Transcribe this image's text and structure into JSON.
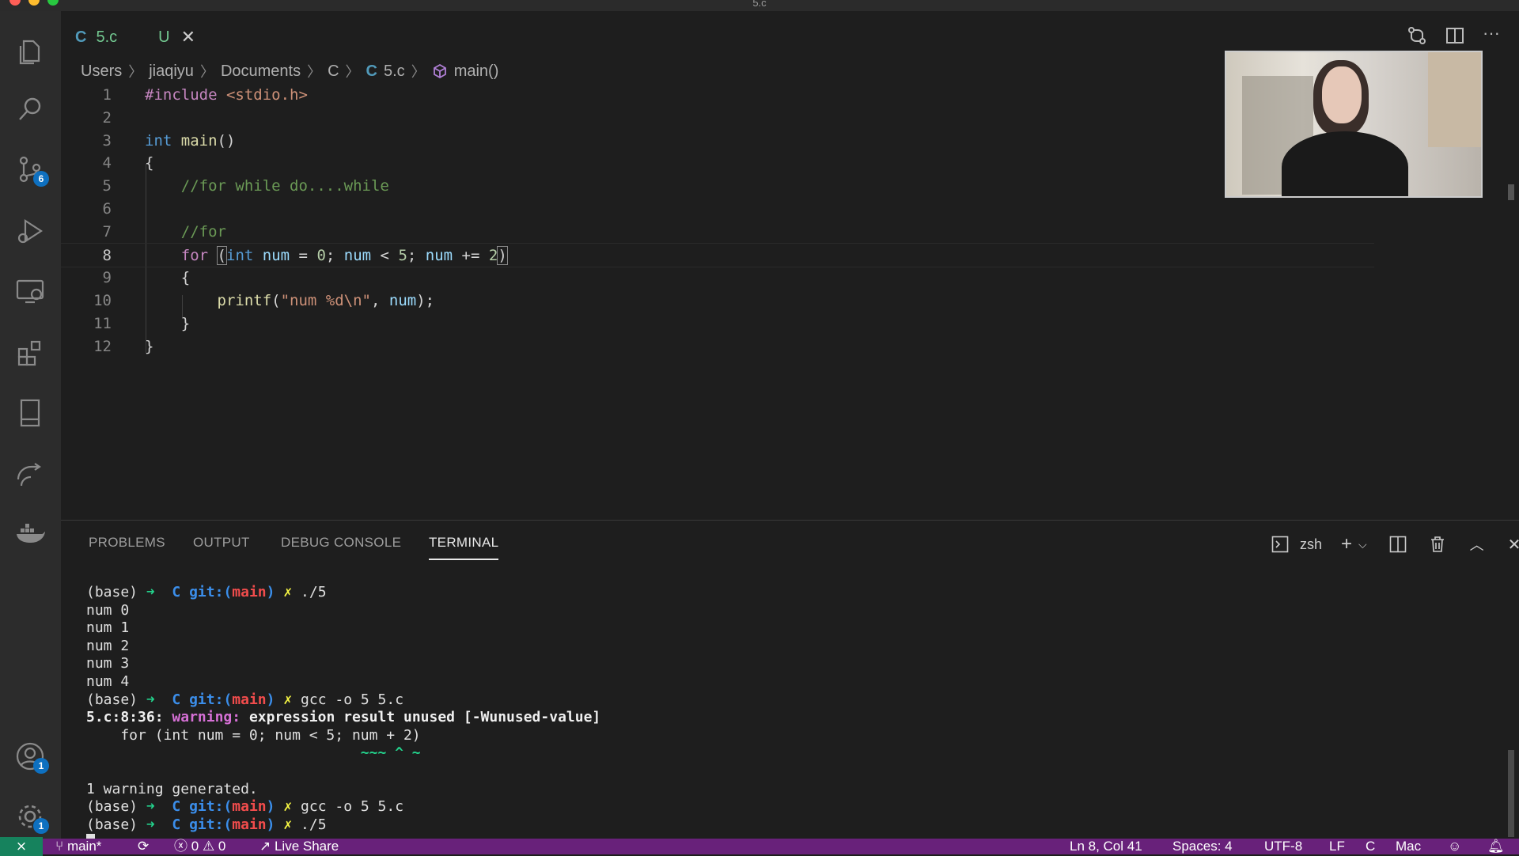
{
  "window": {
    "title": "5.c"
  },
  "tab": {
    "icon_letter": "C",
    "name": "5.c",
    "status": "U"
  },
  "breadcrumb": [
    "Users",
    "jiaqiyu",
    "Documents",
    "C",
    "5.c",
    "main()"
  ],
  "breadcrumb_file_icon": "C",
  "activity_badges": {
    "source_control": "6",
    "accounts": "1",
    "manage": "1"
  },
  "code": {
    "line_numbers": [
      "1",
      "2",
      "3",
      "4",
      "5",
      "6",
      "7",
      "8",
      "9",
      "10",
      "11",
      "12"
    ],
    "l1": {
      "directive": "#include",
      "header": "<stdio.h>"
    },
    "l3": {
      "type": "int",
      "func": "main",
      "rest": "()"
    },
    "l4": "{",
    "l5": "//for while do....while",
    "l7": "//for",
    "l8": {
      "kw_for": "for",
      "open": "(",
      "type": "int",
      "v1": "num",
      "eq": " = ",
      "n0": "0",
      "semi1": "; ",
      "v2": "num",
      "lt": " < ",
      "n5": "5",
      "semi2": "; ",
      "v3": "num",
      "plus": " += ",
      "n2": "2",
      "close": ")"
    },
    "l9": "{",
    "l10": {
      "func": "printf",
      "open": "(",
      "str": "\"num %d\\n\"",
      "mid": ", ",
      "var": "num",
      "end": ");"
    },
    "l11": "}",
    "l12": "}"
  },
  "panel": {
    "tabs": [
      "PROBLEMS",
      "OUTPUT",
      "DEBUG CONSOLE",
      "TERMINAL"
    ],
    "shell": "zsh"
  },
  "terminal": {
    "prompt_base": "(base)",
    "arrow": "➜",
    "dir": "C",
    "git_pre": "git:(",
    "branch": "main",
    "git_post": ")",
    "dirty": "✗",
    "cmd1": "./5",
    "out": [
      "num 0",
      "num 1",
      "num 2",
      "num 3",
      "num 4"
    ],
    "cmd2": "gcc -o 5 5.c",
    "warn_loc": "5.c:8:36:",
    "warn_label": "warning:",
    "warn_msg": "expression result unused [-Wunused-value]",
    "warn_code": "    for (int num = 0; num < 5; num + 2)",
    "warn_caret": "                                ~~~ ^ ~",
    "warn_summary": "1 warning generated.",
    "cmd3": "gcc -o 5 5.c",
    "cmd4": "./5"
  },
  "status": {
    "branch": "main*",
    "errors": "0",
    "warnings": "0",
    "live_share": "Live Share",
    "position": "Ln 8, Col 41",
    "spaces": "Spaces: 4",
    "encoding": "UTF-8",
    "eol": "LF",
    "language": "C",
    "platform": "Mac"
  }
}
